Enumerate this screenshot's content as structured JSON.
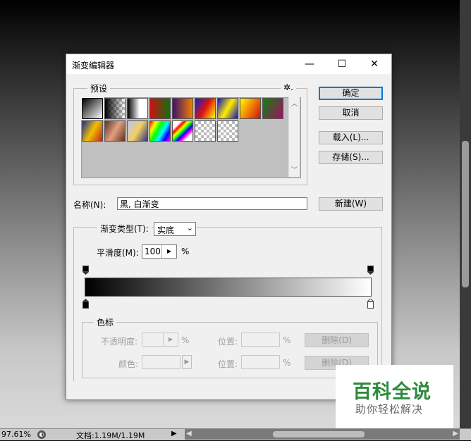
{
  "statusbar": {
    "zoom": "97.61%",
    "doc": "文档:1.19M/1.19M"
  },
  "dialog": {
    "title": "渐变编辑器",
    "controls": {
      "minimize": "—",
      "maximize": "☐",
      "close": "✕"
    },
    "presets": {
      "group_label": "预设",
      "gear": "✲.",
      "swatches": [
        "linear-gradient(135deg,#000,#fff)",
        "checker-black",
        "linear-gradient(90deg,#000 0%,#fff 60%)",
        "linear-gradient(90deg,#d01010,#107010)",
        "linear-gradient(90deg,#401070,#f08000)",
        "linear-gradient(120deg,#1020d0,#e01010,#ff0)",
        "linear-gradient(120deg,#1010c0,#ffee00,#1010c0)",
        "linear-gradient(120deg,#ff0,#f08000,#d01010)",
        "linear-gradient(120deg,#108010,#a01060)",
        "linear-gradient(120deg,#1a2aa0,#f0c000,#c02020)",
        "linear-gradient(120deg,#603020,#e0a080,#603020)",
        "linear-gradient(120deg,#c0c0ff,#f0d060,#303080)",
        "linear-gradient(120deg,#f00,#ff0,#0f0,#0ff,#00f,#f0f)",
        "linear-gradient(135deg,#fff 20%,#f00 30%,#ff0 40%,#0f0 50%,#00f 60%,#f0f 70%,#fff 80%)",
        "checker-light",
        "checker"
      ]
    },
    "buttons": {
      "ok": "确定",
      "cancel": "取消",
      "load": "载入(L)...",
      "save": "存储(S)...",
      "new": "新建(W)"
    },
    "name_label": "名称(N):",
    "name_value": "黑, 白渐变",
    "gradient_type_label": "渐变类型(T):",
    "gradient_type_value": "实底",
    "smoothness_label": "平滑度(M):",
    "smoothness_value": "100",
    "smoothness_unit": "%",
    "stops": {
      "group_label": "色标",
      "opacity_label": "不透明度:",
      "opacity_unit": "%",
      "position_label": "位置:",
      "position_unit": "%",
      "delete_label": "删除(D)",
      "color_label": "颜色:"
    },
    "gradient": {
      "start": "#000000",
      "end": "#ffffff"
    }
  },
  "watermark": {
    "big": "百科全说",
    "small": "助你轻松解决"
  }
}
